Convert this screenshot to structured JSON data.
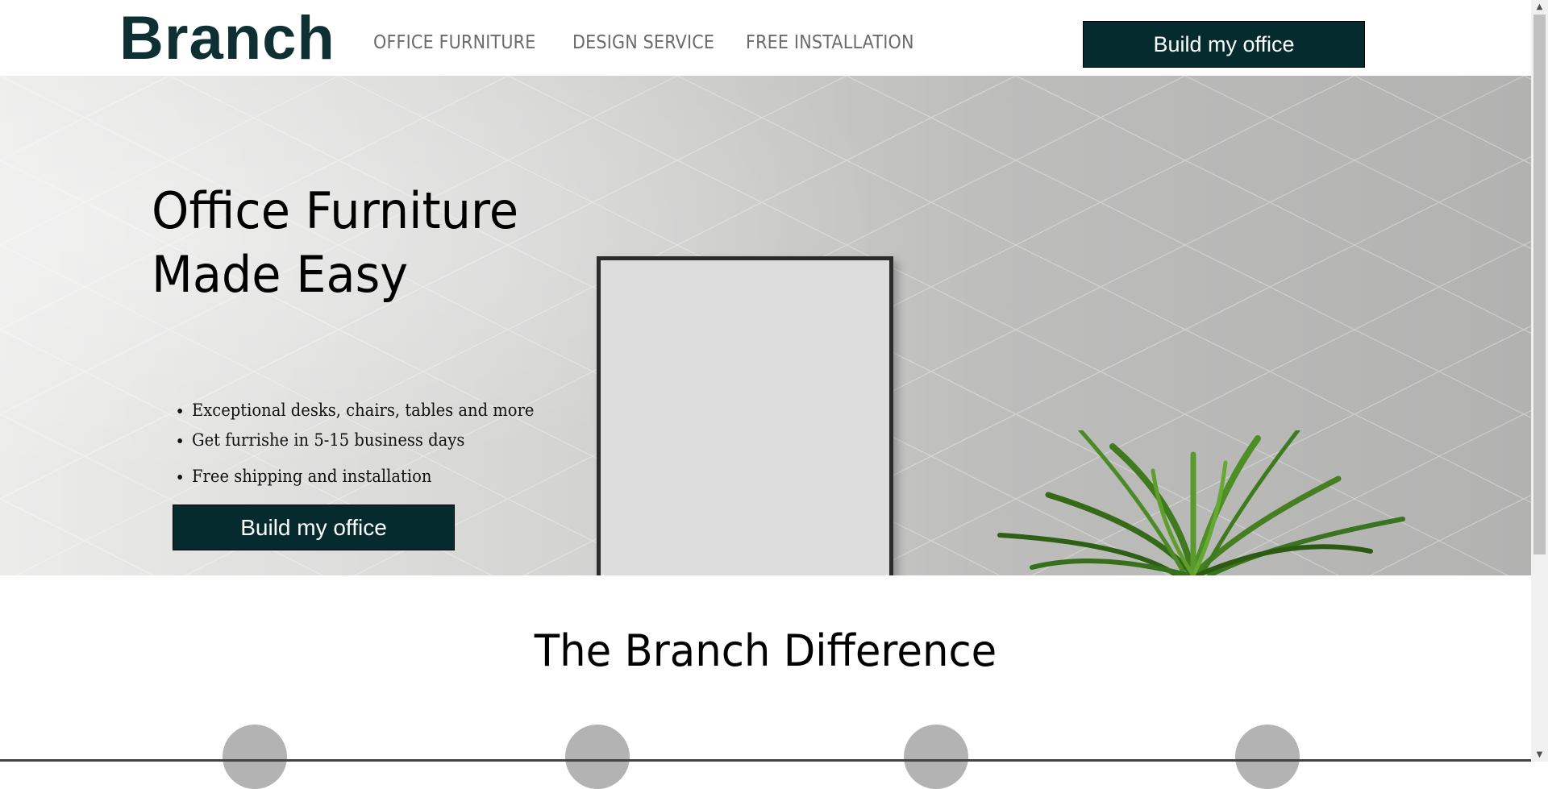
{
  "header": {
    "logo": "Branch",
    "nav": [
      {
        "label": "OFFICE FURNITURE"
      },
      {
        "label": "DESIGN SERVICE"
      },
      {
        "label": "FREE INSTALLATION"
      }
    ],
    "cta_label": "Build my office"
  },
  "hero": {
    "title_line1": "Office Furniture",
    "title_line2": "Made Easy",
    "bullets": [
      "Exceptional desks, chairs, tables and more",
      "Get furrishe in 5-15 business days",
      "Free shipping and installation"
    ],
    "cta_label": "Build my office"
  },
  "difference": {
    "title": "The Branch Difference"
  },
  "colors": {
    "brand_dark": "#062b2e",
    "logo": "#0e3032",
    "nav_text": "#6b6b6b",
    "placeholder_circle": "#b3b3b3"
  }
}
